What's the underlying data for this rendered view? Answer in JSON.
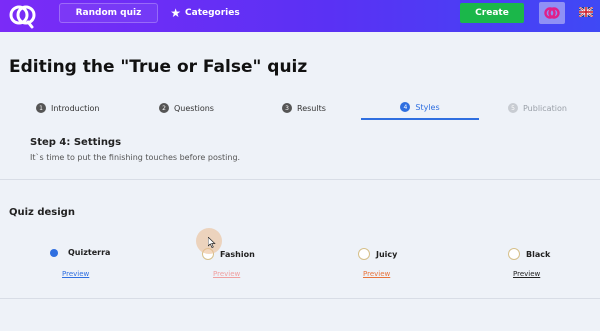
{
  "nav": {
    "random_quiz": "Random quiz",
    "categories": "Categories",
    "create": "Create",
    "accent_color": "#5a31f4",
    "create_color": "#1bb74a"
  },
  "page": {
    "title": "Editing the \"True or False\" quiz"
  },
  "tabs": [
    {
      "num": "1",
      "label": "Introduction"
    },
    {
      "num": "2",
      "label": "Questions"
    },
    {
      "num": "3",
      "label": "Results"
    },
    {
      "num": "4",
      "label": "Styles",
      "state": "active"
    },
    {
      "num": "5",
      "label": "Publication",
      "state": "disabled"
    }
  ],
  "step": {
    "title": "Step 4: Settings",
    "subtitle": "It`s time to put the finishing touches before posting."
  },
  "quiz_design": {
    "title": "Quiz design",
    "options": [
      {
        "label": "Quizterra",
        "preview": "Preview",
        "selected": true,
        "preview_color": "#2f6fe0"
      },
      {
        "label": "Fashion",
        "preview": "Preview",
        "selected": false,
        "preview_color": "#f0a0a0"
      },
      {
        "label": "Juicy",
        "preview": "Preview",
        "selected": false,
        "preview_color": "#e8743b"
      },
      {
        "label": "Black",
        "preview": "Preview",
        "selected": false,
        "preview_color": "#222222"
      }
    ]
  }
}
